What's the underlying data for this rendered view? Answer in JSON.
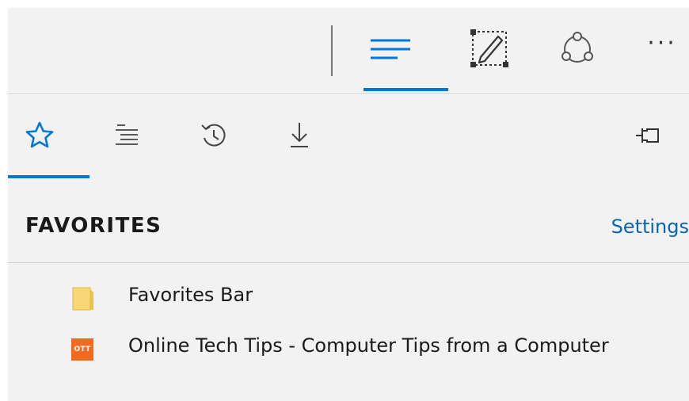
{
  "toolbar": {
    "hub_icon": "hub-lines-icon",
    "notes_icon": "web-note-pen-icon",
    "share_icon": "share-icon",
    "more_label": "···",
    "accent_color": "#0078d7"
  },
  "hub": {
    "tabs": [
      {
        "icon": "star-icon",
        "selected": true
      },
      {
        "icon": "reading-list-icon",
        "selected": false
      },
      {
        "icon": "history-icon",
        "selected": false
      },
      {
        "icon": "download-icon",
        "selected": false
      }
    ],
    "pin_icon": "pin-icon",
    "section_title": "FAVORITES",
    "settings_label": "Settings",
    "items": [
      {
        "label": "Favorites Bar",
        "icon": "folder-icon"
      },
      {
        "label": "Online Tech Tips - Computer Tips from a Computer",
        "badge": "OTT",
        "icon": "site-favicon"
      }
    ]
  }
}
